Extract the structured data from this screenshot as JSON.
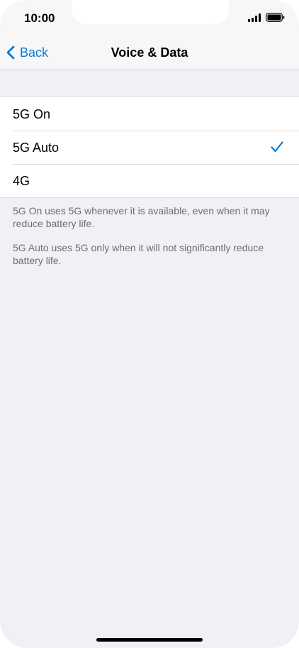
{
  "status_bar": {
    "time": "10:00",
    "signal_icon": "cellular-signal-icon",
    "battery_icon": "battery-icon"
  },
  "nav": {
    "back_label": "Back",
    "back_icon": "chevron-left-icon",
    "title": "Voice & Data"
  },
  "options": [
    {
      "label": "5G On",
      "selected": false
    },
    {
      "label": "5G Auto",
      "selected": true
    },
    {
      "label": "4G",
      "selected": false
    }
  ],
  "footer": {
    "note_1": "5G On uses 5G whenever it is available, even when it may reduce battery life.",
    "note_2": "5G Auto uses 5G only when it will not significantly reduce battery life."
  },
  "colors": {
    "accent": "#0a7ad6",
    "background": "#f0f0f5",
    "secondary_text": "#6e6e73"
  }
}
